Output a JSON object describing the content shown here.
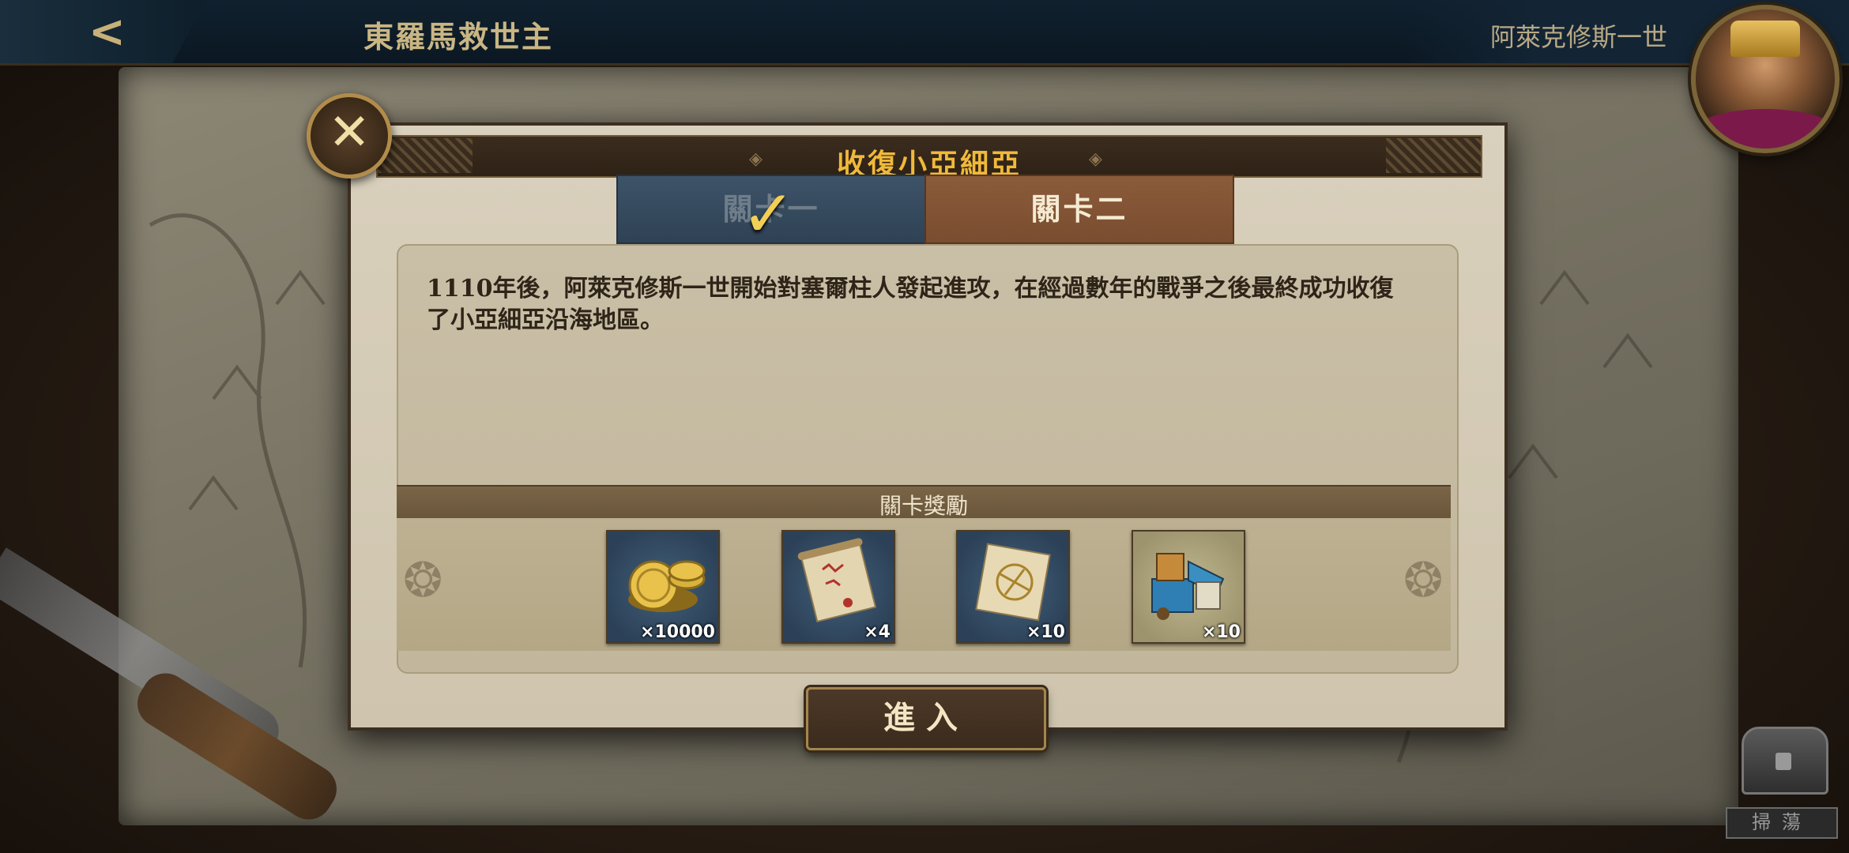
{
  "topbar": {
    "back_label": "<",
    "chapter_title": "東羅馬救世主",
    "hero_name": "阿萊克修斯一世"
  },
  "dialog": {
    "title": "收復小亞細亞",
    "close_glyph": "✕",
    "tabs": [
      {
        "label": "關卡一",
        "completed": true
      },
      {
        "label": "關卡二",
        "completed": false
      }
    ],
    "story": "1110年後，阿萊克修斯一世開始對塞爾柱人發起進攻，在經過數年的戰爭之後最終成功收復了小亞細亞沿海地區。",
    "rewards_label": "關卡獎勵",
    "rewards": [
      {
        "icon": "gold-coins-icon",
        "qty": "×10000"
      },
      {
        "icon": "red-scroll-icon",
        "qty": "×4"
      },
      {
        "icon": "map-scroll-icon",
        "qty": "×10"
      },
      {
        "icon": "siege-engine-icon",
        "qty": "×10"
      }
    ],
    "enter_label": "進入"
  },
  "sweep_label": "掃蕩",
  "colors": {
    "title_gold": "#f0b93a",
    "tab_active": "#8b5b3a",
    "tab_done": "#3d5368"
  }
}
